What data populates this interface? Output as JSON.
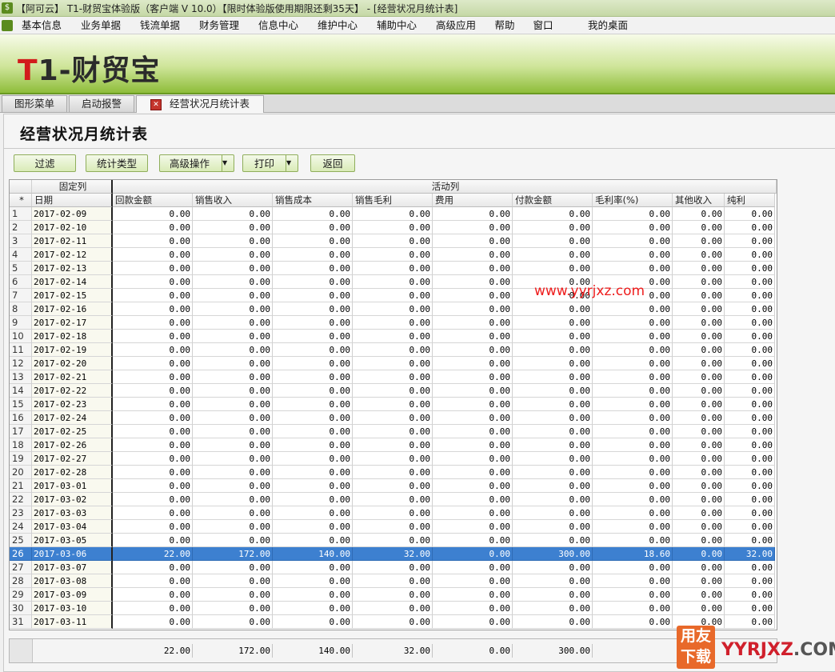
{
  "window": {
    "title": "【阿可云】 T1-财贸宝体验版（客户端 V 10.0）【限时体验版使用期限还剩35天】 - [经营状况月统计表]"
  },
  "menu": [
    "基本信息",
    "业务单据",
    "钱流单据",
    "财务管理",
    "信息中心",
    "维护中心",
    "辅助中心",
    "高级应用",
    "帮助",
    "窗口",
    "我的桌面"
  ],
  "banner": {
    "logo_t": "T",
    "logo_rest": "1-财贸宝"
  },
  "tabs": [
    {
      "label": "图形菜单",
      "active": false
    },
    {
      "label": "启动报警",
      "active": false
    },
    {
      "label": "经营状况月统计表",
      "active": true
    }
  ],
  "page": {
    "title": "经营状况月统计表"
  },
  "toolbar": {
    "filter": "过滤",
    "stat_type": "统计类型",
    "advanced": "高级操作",
    "print": "打印",
    "back": "返回",
    "dropdown_glyph": "▼"
  },
  "table": {
    "group_fixed": "固定列",
    "group_active": "活动列",
    "corner": "*",
    "columns": [
      "日期",
      "回款金额",
      "销售收入",
      "销售成本",
      "销售毛利",
      "费用",
      "付款金额",
      "毛利率(%)",
      "其他收入",
      "纯利"
    ],
    "selected_row": 26,
    "rows": [
      [
        "1",
        "2017-02-09",
        "0.00",
        "0.00",
        "0.00",
        "0.00",
        "0.00",
        "0.00",
        "0.00",
        "0.00",
        "0.00"
      ],
      [
        "2",
        "2017-02-10",
        "0.00",
        "0.00",
        "0.00",
        "0.00",
        "0.00",
        "0.00",
        "0.00",
        "0.00",
        "0.00"
      ],
      [
        "3",
        "2017-02-11",
        "0.00",
        "0.00",
        "0.00",
        "0.00",
        "0.00",
        "0.00",
        "0.00",
        "0.00",
        "0.00"
      ],
      [
        "4",
        "2017-02-12",
        "0.00",
        "0.00",
        "0.00",
        "0.00",
        "0.00",
        "0.00",
        "0.00",
        "0.00",
        "0.00"
      ],
      [
        "5",
        "2017-02-13",
        "0.00",
        "0.00",
        "0.00",
        "0.00",
        "0.00",
        "0.00",
        "0.00",
        "0.00",
        "0.00"
      ],
      [
        "6",
        "2017-02-14",
        "0.00",
        "0.00",
        "0.00",
        "0.00",
        "0.00",
        "0.00",
        "0.00",
        "0.00",
        "0.00"
      ],
      [
        "7",
        "2017-02-15",
        "0.00",
        "0.00",
        "0.00",
        "0.00",
        "0.00",
        "0.00",
        "0.00",
        "0.00",
        "0.00"
      ],
      [
        "8",
        "2017-02-16",
        "0.00",
        "0.00",
        "0.00",
        "0.00",
        "0.00",
        "0.00",
        "0.00",
        "0.00",
        "0.00"
      ],
      [
        "9",
        "2017-02-17",
        "0.00",
        "0.00",
        "0.00",
        "0.00",
        "0.00",
        "0.00",
        "0.00",
        "0.00",
        "0.00"
      ],
      [
        "10",
        "2017-02-18",
        "0.00",
        "0.00",
        "0.00",
        "0.00",
        "0.00",
        "0.00",
        "0.00",
        "0.00",
        "0.00"
      ],
      [
        "11",
        "2017-02-19",
        "0.00",
        "0.00",
        "0.00",
        "0.00",
        "0.00",
        "0.00",
        "0.00",
        "0.00",
        "0.00"
      ],
      [
        "12",
        "2017-02-20",
        "0.00",
        "0.00",
        "0.00",
        "0.00",
        "0.00",
        "0.00",
        "0.00",
        "0.00",
        "0.00"
      ],
      [
        "13",
        "2017-02-21",
        "0.00",
        "0.00",
        "0.00",
        "0.00",
        "0.00",
        "0.00",
        "0.00",
        "0.00",
        "0.00"
      ],
      [
        "14",
        "2017-02-22",
        "0.00",
        "0.00",
        "0.00",
        "0.00",
        "0.00",
        "0.00",
        "0.00",
        "0.00",
        "0.00"
      ],
      [
        "15",
        "2017-02-23",
        "0.00",
        "0.00",
        "0.00",
        "0.00",
        "0.00",
        "0.00",
        "0.00",
        "0.00",
        "0.00"
      ],
      [
        "16",
        "2017-02-24",
        "0.00",
        "0.00",
        "0.00",
        "0.00",
        "0.00",
        "0.00",
        "0.00",
        "0.00",
        "0.00"
      ],
      [
        "17",
        "2017-02-25",
        "0.00",
        "0.00",
        "0.00",
        "0.00",
        "0.00",
        "0.00",
        "0.00",
        "0.00",
        "0.00"
      ],
      [
        "18",
        "2017-02-26",
        "0.00",
        "0.00",
        "0.00",
        "0.00",
        "0.00",
        "0.00",
        "0.00",
        "0.00",
        "0.00"
      ],
      [
        "19",
        "2017-02-27",
        "0.00",
        "0.00",
        "0.00",
        "0.00",
        "0.00",
        "0.00",
        "0.00",
        "0.00",
        "0.00"
      ],
      [
        "20",
        "2017-02-28",
        "0.00",
        "0.00",
        "0.00",
        "0.00",
        "0.00",
        "0.00",
        "0.00",
        "0.00",
        "0.00"
      ],
      [
        "21",
        "2017-03-01",
        "0.00",
        "0.00",
        "0.00",
        "0.00",
        "0.00",
        "0.00",
        "0.00",
        "0.00",
        "0.00"
      ],
      [
        "22",
        "2017-03-02",
        "0.00",
        "0.00",
        "0.00",
        "0.00",
        "0.00",
        "0.00",
        "0.00",
        "0.00",
        "0.00"
      ],
      [
        "23",
        "2017-03-03",
        "0.00",
        "0.00",
        "0.00",
        "0.00",
        "0.00",
        "0.00",
        "0.00",
        "0.00",
        "0.00"
      ],
      [
        "24",
        "2017-03-04",
        "0.00",
        "0.00",
        "0.00",
        "0.00",
        "0.00",
        "0.00",
        "0.00",
        "0.00",
        "0.00"
      ],
      [
        "25",
        "2017-03-05",
        "0.00",
        "0.00",
        "0.00",
        "0.00",
        "0.00",
        "0.00",
        "0.00",
        "0.00",
        "0.00"
      ],
      [
        "26",
        "2017-03-06",
        "22.00",
        "172.00",
        "140.00",
        "32.00",
        "0.00",
        "300.00",
        "18.60",
        "0.00",
        "32.00"
      ],
      [
        "27",
        "2017-03-07",
        "0.00",
        "0.00",
        "0.00",
        "0.00",
        "0.00",
        "0.00",
        "0.00",
        "0.00",
        "0.00"
      ],
      [
        "28",
        "2017-03-08",
        "0.00",
        "0.00",
        "0.00",
        "0.00",
        "0.00",
        "0.00",
        "0.00",
        "0.00",
        "0.00"
      ],
      [
        "29",
        "2017-03-09",
        "0.00",
        "0.00",
        "0.00",
        "0.00",
        "0.00",
        "0.00",
        "0.00",
        "0.00",
        "0.00"
      ],
      [
        "30",
        "2017-03-10",
        "0.00",
        "0.00",
        "0.00",
        "0.00",
        "0.00",
        "0.00",
        "0.00",
        "0.00",
        "0.00"
      ],
      [
        "31",
        "2017-03-11",
        "0.00",
        "0.00",
        "0.00",
        "0.00",
        "0.00",
        "0.00",
        "0.00",
        "0.00",
        "0.00"
      ]
    ],
    "totals": [
      "22.00",
      "172.00",
      "140.00",
      "32.00",
      "0.00",
      "300.00"
    ]
  },
  "watermark": "www.yyrjxz.com",
  "corner_logo": {
    "box_line1": "用友",
    "box_line2": "下载",
    "brand_red": "YYRJXZ",
    "brand_grey": ".COM"
  }
}
